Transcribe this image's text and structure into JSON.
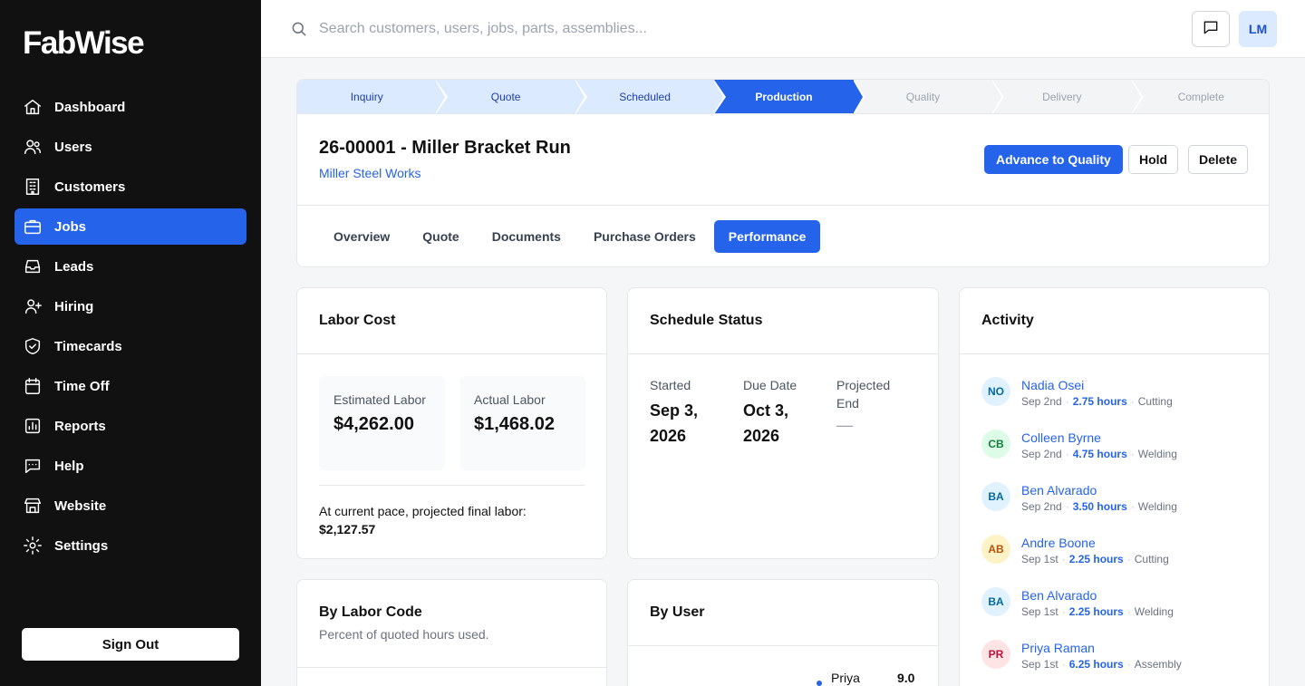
{
  "app": {
    "logo": "FabWise"
  },
  "sidebar": {
    "items": [
      {
        "label": "Dashboard",
        "icon": "home-icon",
        "active": false
      },
      {
        "label": "Users",
        "icon": "users-icon",
        "active": false
      },
      {
        "label": "Customers",
        "icon": "building-icon",
        "active": false
      },
      {
        "label": "Jobs",
        "icon": "briefcase-icon",
        "active": true
      },
      {
        "label": "Leads",
        "icon": "inbox-icon",
        "active": false
      },
      {
        "label": "Hiring",
        "icon": "user-plus-icon",
        "active": false
      },
      {
        "label": "Timecards",
        "icon": "shield-check-icon",
        "active": false
      },
      {
        "label": "Time Off",
        "icon": "calendar-icon",
        "active": false
      },
      {
        "label": "Reports",
        "icon": "bar-chart-icon",
        "active": false
      },
      {
        "label": "Help",
        "icon": "chat-bubble-icon",
        "active": false
      },
      {
        "label": "Website",
        "icon": "storefront-icon",
        "active": false
      },
      {
        "label": "Settings",
        "icon": "gear-icon",
        "active": false
      }
    ],
    "sign_out": "Sign Out"
  },
  "topbar": {
    "search_placeholder": "Search customers, users, jobs, parts, assemblies...",
    "user_initials": "LM"
  },
  "job": {
    "stages": [
      {
        "label": "Inquiry",
        "state": "done"
      },
      {
        "label": "Quote",
        "state": "done"
      },
      {
        "label": "Scheduled",
        "state": "done"
      },
      {
        "label": "Production",
        "state": "current"
      },
      {
        "label": "Quality",
        "state": "todo"
      },
      {
        "label": "Delivery",
        "state": "todo"
      },
      {
        "label": "Complete",
        "state": "todo"
      }
    ],
    "title": "26-00001 - Miller Bracket Run",
    "customer": "Miller Steel Works",
    "actions": {
      "advance": "Advance to Quality",
      "hold": "Hold",
      "delete": "Delete"
    },
    "tabs": [
      {
        "label": "Overview",
        "active": false
      },
      {
        "label": "Quote",
        "active": false
      },
      {
        "label": "Documents",
        "active": false
      },
      {
        "label": "Purchase Orders",
        "active": false
      },
      {
        "label": "Performance",
        "active": true
      }
    ]
  },
  "labor_cost": {
    "title": "Labor Cost",
    "estimated_label": "Estimated Labor",
    "estimated_value": "$4,262.00",
    "actual_label": "Actual Labor",
    "actual_value": "$1,468.02",
    "pace_text": "At current pace, projected final labor:",
    "pace_value": "$2,127.57"
  },
  "schedule": {
    "title": "Schedule Status",
    "started_label": "Started",
    "started_value": "Sep 3, 2026",
    "due_label": "Due Date",
    "due_value": "Oct 3, 2026",
    "projected_label": "Projected End",
    "projected_value": "—"
  },
  "activity": {
    "title": "Activity",
    "items": [
      {
        "initials": "NO",
        "name": "Nadia Osei",
        "date": "Sep 2nd",
        "hours": "2.75 hours",
        "code": "Cutting",
        "bg": "#e0f2fe",
        "fg": "#0369a1"
      },
      {
        "initials": "CB",
        "name": "Colleen Byrne",
        "date": "Sep 2nd",
        "hours": "4.75 hours",
        "code": "Welding",
        "bg": "#dcfce7",
        "fg": "#15803d"
      },
      {
        "initials": "BA",
        "name": "Ben Alvarado",
        "date": "Sep 2nd",
        "hours": "3.50 hours",
        "code": "Welding",
        "bg": "#e0f2fe",
        "fg": "#0369a1"
      },
      {
        "initials": "AB",
        "name": "Andre Boone",
        "date": "Sep 1st",
        "hours": "2.25 hours",
        "code": "Cutting",
        "bg": "#fef3c7",
        "fg": "#b45309"
      },
      {
        "initials": "BA",
        "name": "Ben Alvarado",
        "date": "Sep 1st",
        "hours": "2.25 hours",
        "code": "Welding",
        "bg": "#e0f2fe",
        "fg": "#0369a1"
      },
      {
        "initials": "PR",
        "name": "Priya Raman",
        "date": "Sep 1st",
        "hours": "6.25 hours",
        "code": "Assembly",
        "bg": "#ffe4e6",
        "fg": "#be123c"
      }
    ]
  },
  "by_labor_code": {
    "title": "By Labor Code",
    "subtitle": "Percent of quoted hours used."
  },
  "by_user": {
    "title": "By User",
    "rows": [
      {
        "name": "Priya",
        "value": "9.0"
      }
    ]
  }
}
